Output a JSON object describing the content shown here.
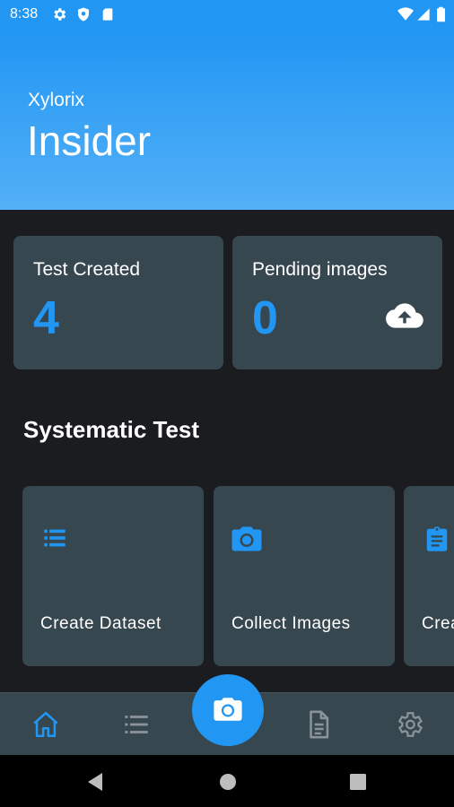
{
  "status_bar": {
    "time": "8:38",
    "left_icons": [
      "gear-icon",
      "shield-icon",
      "sd-card-icon"
    ],
    "right_icons": [
      "wifi-icon",
      "signal-icon",
      "battery-icon"
    ]
  },
  "header": {
    "brand": "Xylorix",
    "title": "Insider"
  },
  "stats": [
    {
      "label": "Test Created",
      "value": "4"
    },
    {
      "label": "Pending images",
      "value": "0",
      "icon": "cloud-upload-icon"
    }
  ],
  "section": {
    "title": "Systematic Test"
  },
  "tiles": [
    {
      "label": "Create Dataset",
      "icon": "list-icon"
    },
    {
      "label": "Collect Images",
      "icon": "camera-icon"
    },
    {
      "label": "Crea",
      "icon": "clipboard-icon"
    }
  ],
  "bottom_nav": {
    "items": [
      "home-icon",
      "list-icon",
      "document-icon",
      "settings-icon"
    ],
    "active": "home-icon",
    "fab_icon": "camera-icon"
  },
  "colors": {
    "accent": "#2196f3",
    "card": "#37474f",
    "background": "#1b1c20",
    "nav_inactive": "#8a9399"
  }
}
